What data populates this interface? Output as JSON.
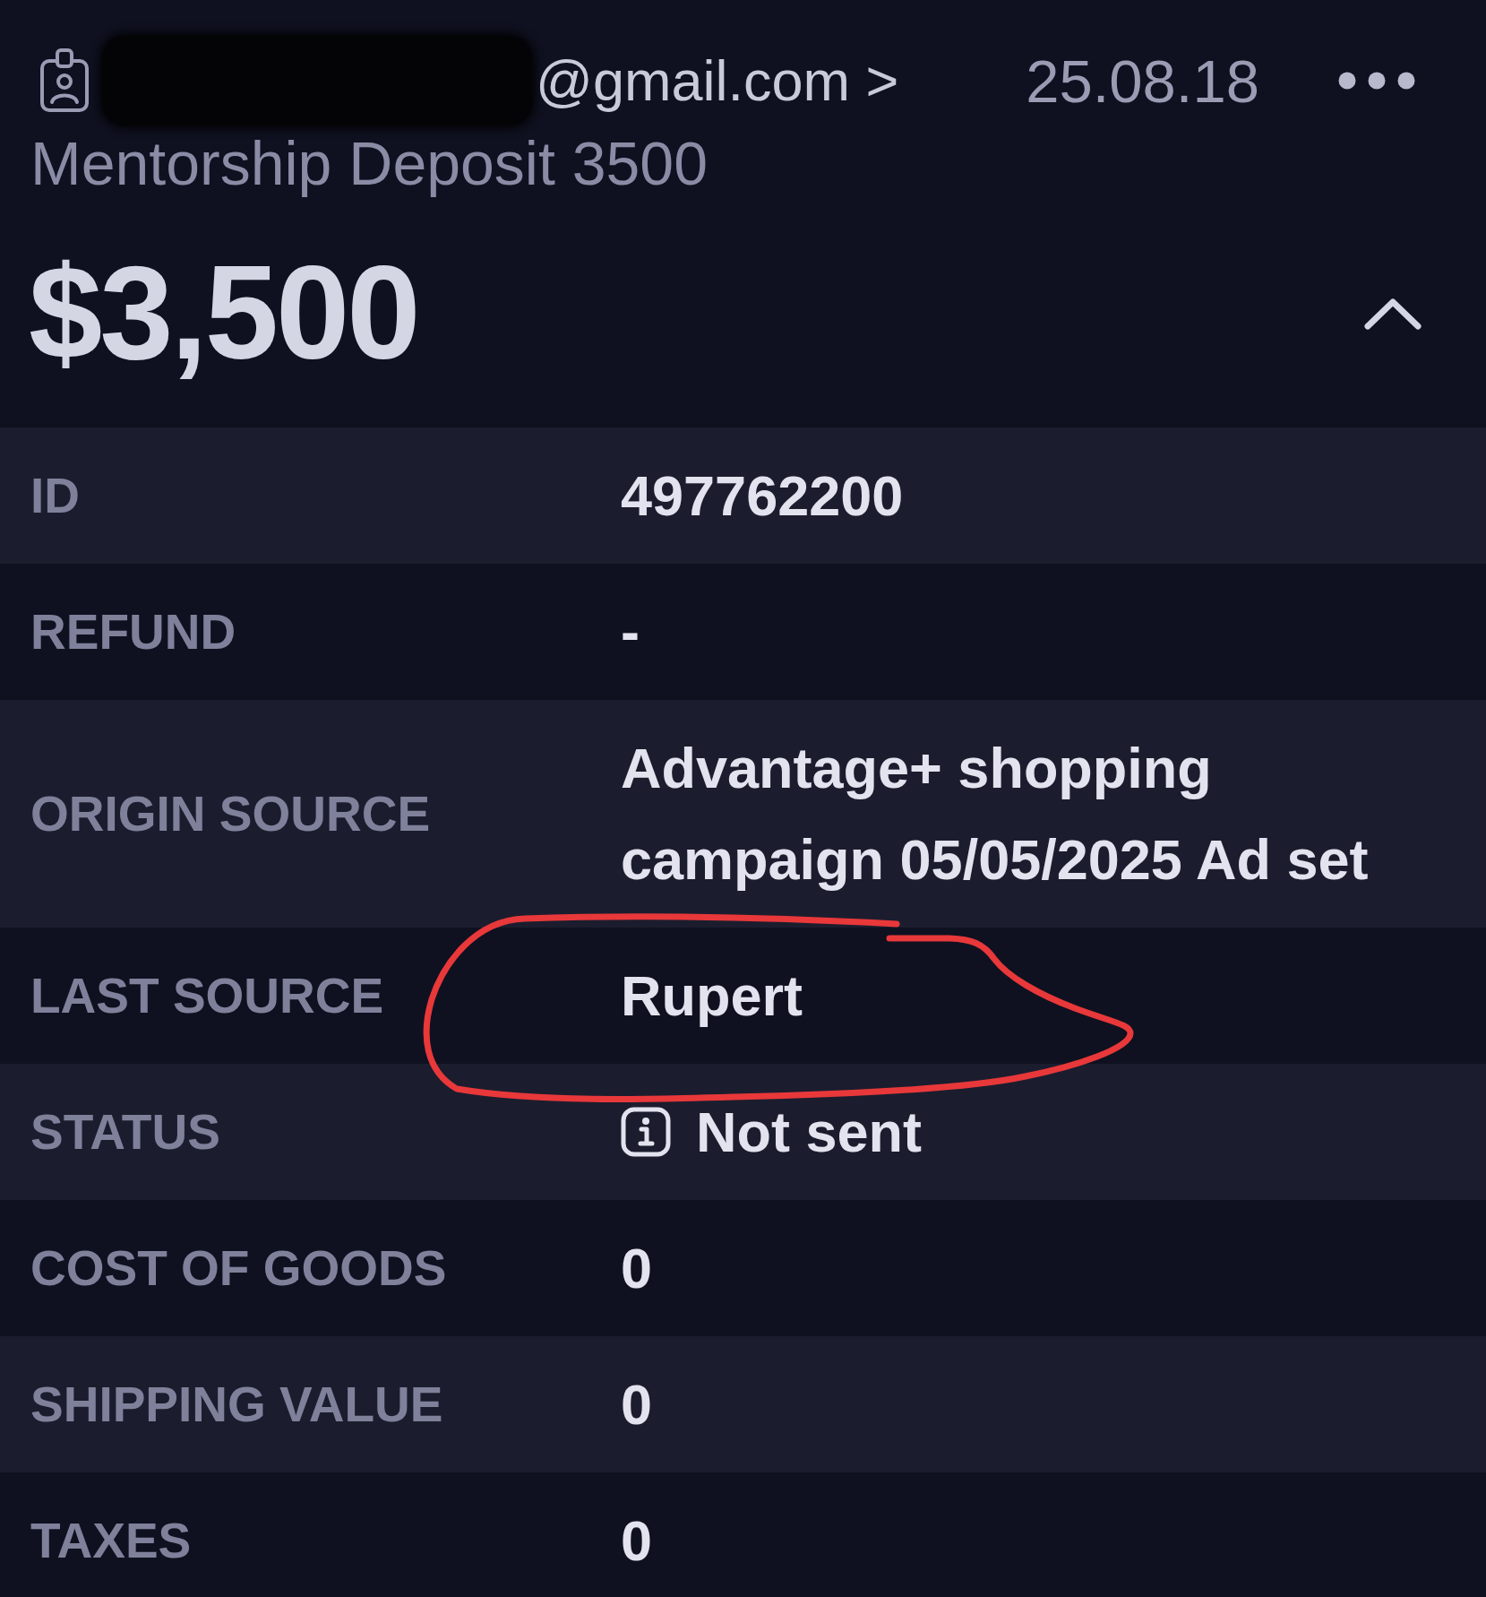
{
  "header": {
    "email_redacted": true,
    "email": "@gmail.com >",
    "date": "25.08.18"
  },
  "title": "Mentorship Deposit 3500",
  "amount": "$3,500",
  "expanded": true,
  "details": [
    {
      "kind": "text",
      "label": "ID",
      "value": "497762200",
      "circled": false
    },
    {
      "kind": "text",
      "label": "REFUND",
      "value": "-",
      "circled": false
    },
    {
      "kind": "text",
      "label": "ORIGIN SOURCE",
      "value": "Advantage+ shopping campaign 05/05/2025 Ad set",
      "circled": false
    },
    {
      "kind": "text",
      "label": "LAST SOURCE",
      "value": "Rupert",
      "circled": true
    },
    {
      "kind": "status",
      "label": "STATUS",
      "value": "Not sent",
      "circled": false
    },
    {
      "kind": "text",
      "label": "COST OF GOODS",
      "value": "0",
      "circled": false
    },
    {
      "kind": "text",
      "label": "SHIPPING VALUE",
      "value": "0",
      "circled": false
    },
    {
      "kind": "text",
      "label": "TAXES",
      "value": "0",
      "circled": false
    }
  ]
}
